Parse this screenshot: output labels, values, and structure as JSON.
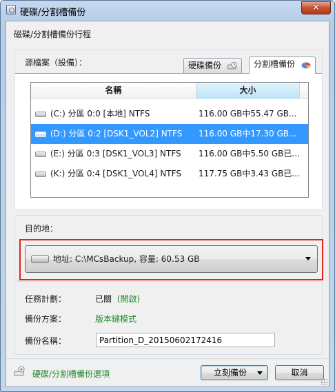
{
  "window": {
    "title": "硬碟/分割槽備份",
    "close_label": "✕"
  },
  "header": {
    "label": "磁碟/分割槽備份行程"
  },
  "source": {
    "label": "源檔案（設備）：",
    "tabs": [
      {
        "label": "硬碟備份",
        "icon": "disk-clock-icon",
        "active": false
      },
      {
        "label": "分割槽備份",
        "icon": "partition-pie-icon",
        "active": true
      }
    ],
    "columns": {
      "name": "名稱",
      "size": "大小"
    },
    "rows": [
      {
        "name": "(C:) 分區 0:0 [本地]   NTFS",
        "size": "116.00 GB中55.47 GB...",
        "selected": false
      },
      {
        "name": "(D:) 分區 0:2 [DSK1_VOL2]   NTFS",
        "size": "116.00 GB中17.30 GB...",
        "selected": true
      },
      {
        "name": "(E:) 分區 0:3 [DSK1_VOL3]   NTFS",
        "size": "116.00 GB中5.50 GB已...",
        "selected": false
      },
      {
        "name": "(K:) 分區 0:4 [DSK1_VOL4]   NTFS",
        "size": "117.75 GB中3.43 GB已...",
        "selected": false
      }
    ]
  },
  "destination": {
    "label": "目的地：",
    "value": "地址: C:\\MCsBackup, 容量: 60.53 GB"
  },
  "info": {
    "schedule_label": "任務計劃：",
    "schedule_value": "已關",
    "schedule_link": "(開啟)",
    "scheme_label": "備份方案：",
    "scheme_value": "版本鏈模式",
    "name_label": "備份名稱：",
    "name_value": "Partition_D_20150602172416"
  },
  "footer": {
    "options_label": "硬碟/分割槽備份選項",
    "backup_button": "立刻備份",
    "cancel_button": "取消"
  },
  "colors": {
    "selection": "#3399ff",
    "highlight_border": "#e2231a",
    "link_green": "#1e8a2a"
  }
}
